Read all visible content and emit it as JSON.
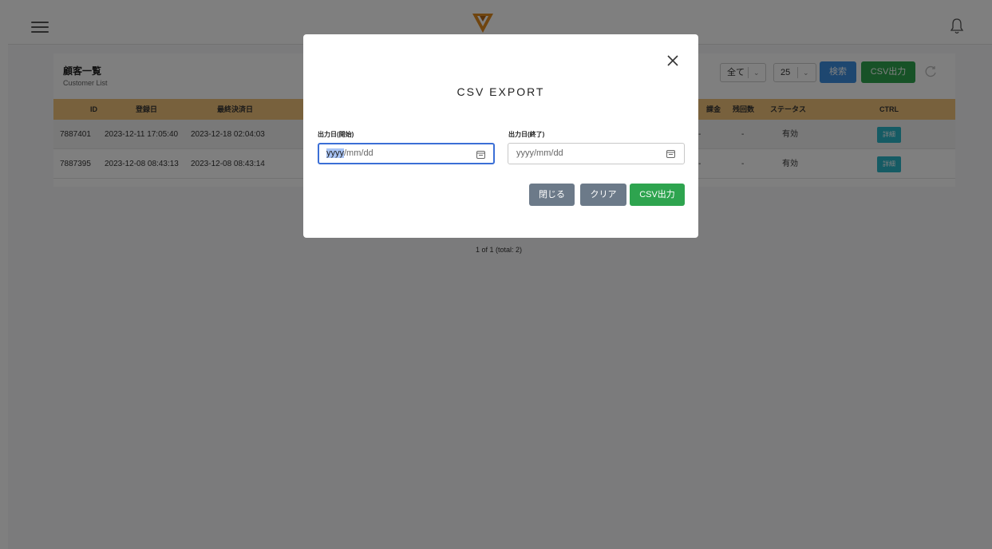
{
  "customer_list": {
    "title": "顧客一覧",
    "subtitle": "Customer List",
    "filter_select": "全て",
    "page_size_select": "25",
    "search_label": "検索",
    "csv_label": "CSV出力"
  },
  "table": {
    "headers": [
      "ID",
      "登録日",
      "最終決済日",
      "課金",
      "残回数",
      "ステータス",
      "CTRL"
    ],
    "rows": [
      {
        "id": "7887401",
        "registered": "2023-12-11 17:05:40",
        "last_payment": "2023-12-18 02:04:03",
        "billing": "-",
        "remaining": "-",
        "status": "有効",
        "detail": "詳細"
      },
      {
        "id": "7887395",
        "registered": "2023-12-08 08:43:13",
        "last_payment": "2023-12-08 08:43:14",
        "billing": "-",
        "remaining": "-",
        "status": "有効",
        "detail": "詳細"
      }
    ]
  },
  "pagination": "1 of 1 (total: 2)",
  "modal": {
    "title": "CSV EXPORT",
    "start_label": "出力日(開始)",
    "end_label": "出力日(終了)",
    "start_highlight": "yyyy",
    "start_rest": "/mm/dd",
    "end_value": "yyyy/mm/dd",
    "close_label": "閉じる",
    "clear_label": "クリア",
    "export_label": "CSV出力"
  },
  "colors": {
    "header_bg": "#f0c27b",
    "export_green": "#2ea44f",
    "search_blue": "#3d8fe0",
    "detail_teal": "#2bb6c8",
    "gray_button": "#6c7a89",
    "logo_orange": "#e08a1e"
  },
  "icons": {
    "menu": "hamburger-icon",
    "logo": "logo-v-icon",
    "notifications": "bell-icon",
    "refresh": "refresh-icon",
    "close": "close-icon",
    "calendar": "calendar-icon"
  }
}
